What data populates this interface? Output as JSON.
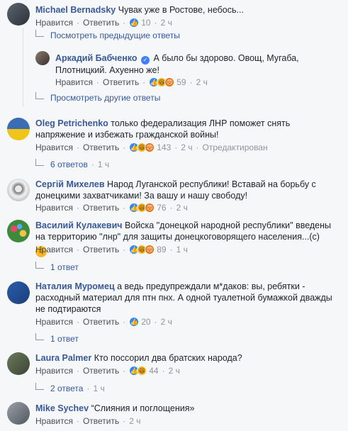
{
  "ui": {
    "like": "Нравится",
    "reply": "Ответить",
    "edited": "Отредактирован"
  },
  "comments": [
    {
      "author": "Michael Bernadsky",
      "text": "Чувак уже в Ростове, небось...",
      "count": "10",
      "time": "2 ч"
    },
    {
      "replies_prev": "Посмотреть предыдущие ответы"
    },
    {
      "author": "Аркадий Бабченко",
      "text": "А было бы здорово. Овощ, Мугаба, Плотницкий. Ахуенно же!",
      "count": "59",
      "time": "2 ч"
    },
    {
      "replies_more": "Просмотреть другие ответы"
    },
    {
      "author": "Oleg Petrichenko",
      "text": "только федерализация ЛНР поможет снять напряжение и избежать гражданской войны!",
      "count": "143",
      "time": "2 ч",
      "replies": "6 ответов",
      "replies_time": "1 ч"
    },
    {
      "author": "Сергій Михелев",
      "text": "Народ Луганской республики! Вставай на борьбу с донецкими захватчиками! За вашу и нашу свободу!",
      "count": "76",
      "time": "2 ч"
    },
    {
      "author": "Василий Кулакевич",
      "text": "Войска \"донецкой народной республики\" введены на территорию \"лнр\" для защиты донецкоговорящего населения...(с)",
      "count": "89",
      "time": "1 ч",
      "replies": "1 ответ"
    },
    {
      "author": "Наталия Муромец",
      "text": "а ведь предупреждали м*даков: вы, ребятки - расходный материал для птн пнх. А одной туалетной бумажкой дважды не подтираются",
      "count": "20",
      "time": "2 ч",
      "replies": "1 ответ"
    },
    {
      "author": "Laura Palmer",
      "text": "Кто поссорил два братских народа?",
      "count": "44",
      "time": "2 ч",
      "replies": "2 ответа",
      "replies_time": "1 ч"
    },
    {
      "author": "Mike Sychev",
      "text": "“Слияния и поглощения»",
      "time": "2 ч"
    }
  ]
}
